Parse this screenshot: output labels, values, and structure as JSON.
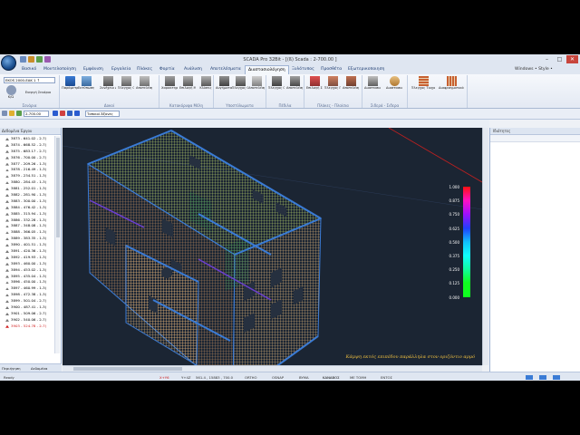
{
  "window": {
    "title": "SCADA Pro 32Bit - [(ß) Scada : 2-700.00 ]",
    "right_label": "Windows • Style •",
    "controls": [
      "–",
      "□",
      "✕"
    ]
  },
  "tabs": [
    "Βασικό",
    "Μοντελοποίηση",
    "Εμφάνιση",
    "Εργαλεία",
    "Πλάκες",
    "Φορτία",
    "Ανάλυση",
    "Αποτελέσματα",
    "Διαστασιολόγηση",
    "Ξυλότυπος",
    "Προσθέτα",
    "Εξωτερικοποιηση"
  ],
  "active_tab": "Διαστασιολόγηση",
  "ribbon": {
    "combo_value": "EKOS 2000-EAK 1 ↑",
    "groups": [
      {
        "label": "Σενάρια",
        "buttons": [
          "Κ/Ω",
          "Ενεργή Σενάριο"
        ]
      },
      {
        "label": "Δοκοί",
        "buttons": [
          "Παράμετροι",
          "Εκτύπωση Μελών",
          "Συνέχεια Δοκών",
          "Έλεγχος Οπλίσεις",
          "Αποτελέσματα"
        ]
      },
      {
        "label": "Κατακόρυφα Μέλη",
        "buttons": [
          "Χαρακτηριστικά",
          "Επιλογή Μέλους",
          "Κλίσεις"
        ]
      },
      {
        "label": "Υποστύλωματα",
        "buttons": [
          "Αυγήματα",
          "Έλεγχος Οπλισμού",
          "Αποτελέσματα"
        ]
      },
      {
        "label": "Πέδιλα",
        "buttons": [
          "Έλεγχος Οπλίσεις",
          "Αποτελέσματα"
        ]
      },
      {
        "label": "Πλάκες - Πλαίσια",
        "buttons": [
          "Επιλογή Στοιχείων",
          "Έλεγχος Πλακών",
          "Αποτελέσματα"
        ]
      },
      {
        "label": "Σιδερά - Σιδερα",
        "buttons": [
          "Διαστασιολόγηση",
          "Διαστασιολόγηση"
        ]
      },
      {
        "label": "",
        "buttons": [
          "Έλεγχος Τοιχοποιίας",
          "Διαφραγματικά Μέλους"
        ]
      }
    ]
  },
  "toolbar": {
    "layer_value": "2-700.00",
    "selection_value": "Τοπικοί Άξονες"
  },
  "left_panel": {
    "header": "Δεδομένα Έργου",
    "rows": [
      "3873 - 641.02 - 2-7(",
      "3874 - 668.52 - 2-7(",
      "3875 - 683.17 - 2-7(",
      "3876 - 700.00 - 2-7(",
      "3877 - 209.26 - 1-3(",
      "3878 - 216.49 - 1-3(",
      "3879 - 234.51 - 1-3(",
      "3880 - 284.43 - 1-3(",
      "3881 - 252.01 - 1-3(",
      "3882 - 281.90 - 1-3(",
      "3883 - 300.00 - 1-3(",
      "3884 - 476.42 - 1-3(",
      "3885 - 315.94 - 1-3(",
      "3886 - 332.28 - 1-3(",
      "3887 - 348.08 - 1-3(",
      "3888 - 366.05 - 1-3(",
      "3889 - 383.35 - 1-3(",
      "3890 - 401.51 - 1-3(",
      "3891 - 420.36 - 1-3(",
      "3892 - 419.93 - 1-3(",
      "3893 - 460.00 - 1-3(",
      "3894 - 453.02 - 1-3(",
      "3895 - 435.04 - 1-3(",
      "3896 - 450.00 - 1-3(",
      "3897 - 460.99 - 1-3(",
      "3898 - 472.38 - 1-3(",
      "3899 - 501.04 - 2-7(",
      "3900 - 487.41 - 1-3(",
      "3901 - 509.06 - 2-7(",
      "3902 - 540.06 - 2-7(",
      "3903 - 524.78 - 2-7("
    ],
    "selected_index": 30,
    "tabs": [
      "Περιήγηση",
      "Δεδομένα"
    ]
  },
  "right_panel": {
    "header": "Ιδιότητες"
  },
  "legend": {
    "labels": [
      "1.000",
      "0.875",
      "0.750",
      "0.625",
      "0.500",
      "0.375",
      "0.250",
      "0.125",
      "0.000"
    ],
    "colors": [
      "#ff1010",
      "#ff10c0",
      "#a010ff",
      "#2040ff",
      "#10c0ff",
      "#10ffff",
      "#10ffa0",
      "#10ff20"
    ]
  },
  "viewport_caption": "Κάμψη εκτός επιπέδου παράλληλα στον οριζόντιο αρμό",
  "statusbar": {
    "items": [
      "Ready",
      "X+Y6",
      "Y+4Z",
      "561.4 , 15883 , 700.0",
      "ORTHO",
      "OSNAP",
      "BYMA",
      "ΚΑΝΑΒΟΣ",
      "ΜΕ ΤΟΜΗ",
      "ΕΝΤΟΣ"
    ]
  },
  "colors": {
    "viewport_bg": "#1b2533",
    "mesh": "#f0c080",
    "roof_mesh": "#c8e070",
    "accent_blue": "#3a7bd5"
  }
}
